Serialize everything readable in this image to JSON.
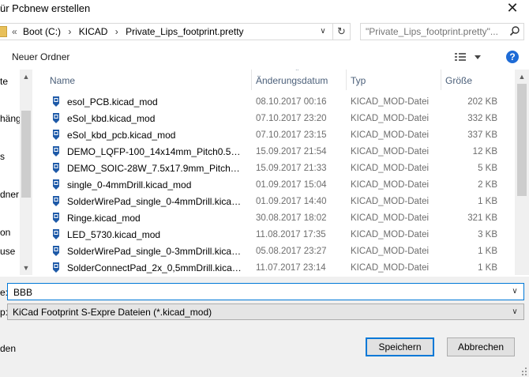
{
  "window": {
    "title": "ür Pcbnew erstellen",
    "close_glyph": "✕"
  },
  "address": {
    "overflow_glyph": "«",
    "crumbs": [
      "Boot (C:)",
      "KICAD",
      "Private_Lips_footprint.pretty"
    ],
    "separator": "›"
  },
  "search": {
    "placeholder": "\"Private_Lips_footprint.pretty\"..."
  },
  "toolbar": {
    "new_folder_label": "Neuer Ordner",
    "help_label": "?"
  },
  "nav": {
    "items": [
      "te",
      "hängi",
      "s",
      "dner",
      "on",
      "use"
    ]
  },
  "columns": {
    "name": "Name",
    "date": "Änderungsdatum",
    "type": "Typ",
    "size": "Größe"
  },
  "files": [
    {
      "name": "esol_PCB.kicad_mod",
      "date": "08.10.2017 00:16",
      "type": "KICAD_MOD-Datei",
      "size": "202 KB"
    },
    {
      "name": "eSol_kbd.kicad_mod",
      "date": "07.10.2017 23:20",
      "type": "KICAD_MOD-Datei",
      "size": "332 KB"
    },
    {
      "name": "eSol_kbd_pcb.kicad_mod",
      "date": "07.10.2017 23:15",
      "type": "KICAD_MOD-Datei",
      "size": "337 KB"
    },
    {
      "name": "DEMO_LQFP-100_14x14mm_Pitch0.5mm...",
      "date": "15.09.2017 21:54",
      "type": "KICAD_MOD-Datei",
      "size": "12 KB"
    },
    {
      "name": "DEMO_SOIC-28W_7.5x17.9mm_Pitch1.27...",
      "date": "15.09.2017 21:33",
      "type": "KICAD_MOD-Datei",
      "size": "5 KB"
    },
    {
      "name": "single_0-4mmDrill.kicad_mod",
      "date": "01.09.2017 15:04",
      "type": "KICAD_MOD-Datei",
      "size": "2 KB"
    },
    {
      "name": "SolderWirePad_single_0-4mmDrill.kicad_...",
      "date": "01.09.2017 14:40",
      "type": "KICAD_MOD-Datei",
      "size": "1 KB"
    },
    {
      "name": "Ringe.kicad_mod",
      "date": "30.08.2017 18:02",
      "type": "KICAD_MOD-Datei",
      "size": "321 KB"
    },
    {
      "name": "LED_5730.kicad_mod",
      "date": "11.08.2017 17:35",
      "type": "KICAD_MOD-Datei",
      "size": "3 KB"
    },
    {
      "name": "SolderWirePad_single_0-3mmDrill.kicad_...",
      "date": "05.08.2017 23:27",
      "type": "KICAD_MOD-Datei",
      "size": "1 KB"
    },
    {
      "name": "SolderConnectPad_2x_0,5mmDrill.kicad_...",
      "date": "11.07.2017 23:14",
      "type": "KICAD_MOD-Datei",
      "size": "1 KB"
    }
  ],
  "filename": {
    "label": "e:",
    "value": "BBB"
  },
  "filetype": {
    "label": "p:",
    "value": "KiCad Footprint S-Expre Dateien (*.kicad_mod)"
  },
  "footer": {
    "hide_label": "den",
    "save_label": "Speichern",
    "cancel_label": "Abbrechen"
  },
  "colors": {
    "accent": "#0078d7",
    "header_text": "#4c607a",
    "icon_blue": "#1e5aa8"
  }
}
